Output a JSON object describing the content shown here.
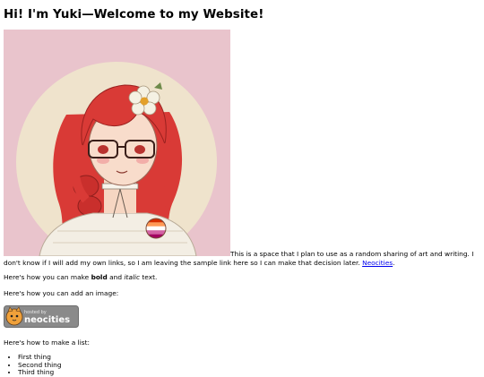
{
  "page": {
    "heading": "Hi! I'm Yuki—Welcome to my Website!",
    "intro_text": "This is a space that I plan to use as a random sharing of art and writing. I don't know if I will add my own links, so I am leaving the sample link here so I can make that decision later.",
    "intro_link": "Neocities",
    "intro_end": ".",
    "format_prefix": "Here's how you can make ",
    "format_bold": "bold",
    "format_and": " and ",
    "format_italic": "italic",
    "format_suffix": " text.",
    "image_text": "Here's how you can add an image:",
    "list_intro": "Here's how to make a list:",
    "list_items": [
      "First thing",
      "Second thing",
      "Third thing"
    ]
  },
  "badge": {
    "hosted_by": "hosted by",
    "brand": "neocities"
  },
  "colors": {
    "avatar_bg": "#e9c4cc",
    "halo": "#efe3cc",
    "hair": "#d93a36",
    "link": "#0000ee",
    "badge_bg": "#8a8a8a"
  }
}
